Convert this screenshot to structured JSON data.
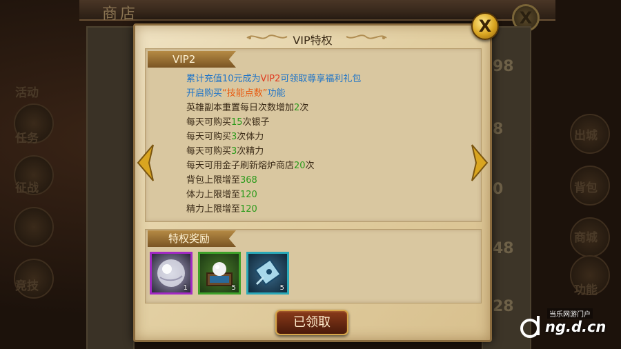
{
  "dialog": {
    "title": "VIP特权",
    "vip_level_label": "VIP2",
    "perk_lines": [
      {
        "parts": [
          {
            "text": "累计充值10元成为",
            "color": "blue"
          },
          {
            "text": "VIP2",
            "color": "red"
          },
          {
            "text": "可领取尊享福利礼包",
            "color": "blue"
          }
        ]
      },
      {
        "parts": [
          {
            "text": "开启购买",
            "color": "blue"
          },
          {
            "text": "“技能点数”",
            "color": "orange"
          },
          {
            "text": "功能",
            "color": "blue"
          }
        ]
      },
      {
        "parts": [
          {
            "text": "英雄副本重置每日次数增加",
            "color": "normal"
          },
          {
            "text": "2",
            "color": "green"
          },
          {
            "text": "次",
            "color": "normal"
          }
        ]
      },
      {
        "parts": [
          {
            "text": "每天可购买",
            "color": "normal"
          },
          {
            "text": "15",
            "color": "green"
          },
          {
            "text": "次银子",
            "color": "normal"
          }
        ]
      },
      {
        "parts": [
          {
            "text": "每天可购买",
            "color": "normal"
          },
          {
            "text": "3",
            "color": "green"
          },
          {
            "text": "次体力",
            "color": "normal"
          }
        ]
      },
      {
        "parts": [
          {
            "text": "每天可购买",
            "color": "normal"
          },
          {
            "text": "3",
            "color": "green"
          },
          {
            "text": "次精力",
            "color": "normal"
          }
        ]
      },
      {
        "parts": [
          {
            "text": "每天可用金子刷新熔炉商店",
            "color": "normal"
          },
          {
            "text": "20",
            "color": "green"
          },
          {
            "text": "次",
            "color": "normal"
          }
        ]
      },
      {
        "parts": [
          {
            "text": "背包上限增至",
            "color": "normal"
          },
          {
            "text": "368",
            "color": "green"
          }
        ]
      },
      {
        "parts": [
          {
            "text": "体力上限增至",
            "color": "normal"
          },
          {
            "text": "120",
            "color": "green"
          }
        ]
      },
      {
        "parts": [
          {
            "text": "精力上限增至",
            "color": "normal"
          },
          {
            "text": "120",
            "color": "green"
          }
        ]
      }
    ],
    "reward_section_label": "特权奖励",
    "reward_items": [
      {
        "icon": "crystal-orb-icon",
        "count": "1",
        "rarity_color": "#a22ac4"
      },
      {
        "icon": "treasure-chest-pearl-icon",
        "count": "5",
        "rarity_color": "#3ea12a"
      },
      {
        "icon": "scroll-ticket-icon",
        "count": "5",
        "rarity_color": "#2aa8b8"
      }
    ],
    "claim_button_label": "已领取",
    "close_label": "X"
  },
  "background": {
    "shop_title": "商店",
    "close_label": "X",
    "right_numbers": [
      "98",
      "8",
      "0",
      "48",
      "28"
    ],
    "left_side_labels": [
      "活动",
      "任务",
      "征战",
      "竞技"
    ],
    "right_side_labels": [
      "出城",
      "背包",
      "商城",
      "功能"
    ]
  },
  "watermark": {
    "site_label": "当乐网游门户",
    "domain": "ng.d.cn"
  },
  "colors": {
    "parchment": "#e2cfa2",
    "blue_text": "#1e74c8",
    "red_text": "#e03a20",
    "green_text": "#2a9a1a",
    "gold_ribbon": "#b58a44"
  }
}
